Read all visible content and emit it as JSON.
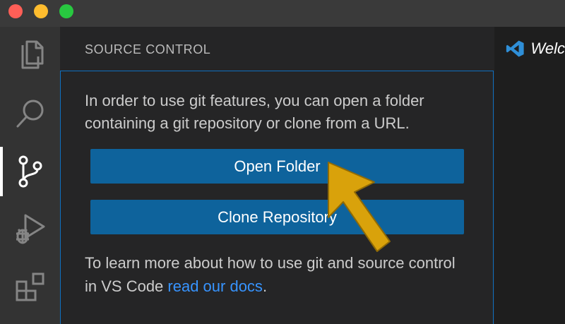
{
  "window": {
    "traffic_lights": {
      "close_color": "#ff5f57",
      "minimize_color": "#febc2e",
      "maximize_color": "#28c840"
    }
  },
  "activity_bar": {
    "items": [
      {
        "icon": "explorer-icon",
        "active": false
      },
      {
        "icon": "search-icon",
        "active": false
      },
      {
        "icon": "source-control-icon",
        "active": true
      },
      {
        "icon": "run-debug-icon",
        "active": false
      },
      {
        "icon": "extensions-icon",
        "active": false
      }
    ]
  },
  "sidebar": {
    "title": "SOURCE CONTROL",
    "intro_text": "In order to use git features, you can open a folder containing a git repository or clone from a URL.",
    "open_folder_label": "Open Folder",
    "clone_repository_label": "Clone Repository",
    "learn_prefix": "To learn more about how to use git and source control in VS Code ",
    "docs_link": "read our docs",
    "learn_suffix": "."
  },
  "editor": {
    "tab_label": "Welc",
    "tab_icon": "vscode-logo-icon"
  },
  "annotation": {
    "icon": "pointer-arrow-icon",
    "color": "#d9a20b",
    "target": "open-folder-button"
  },
  "colors": {
    "accent": "#0e70c0",
    "button": "#0e639c",
    "link": "#3794ff",
    "sidebar_bg": "#252526",
    "activity_bar_bg": "#333333",
    "title_bar_bg": "#3a3a3a"
  }
}
